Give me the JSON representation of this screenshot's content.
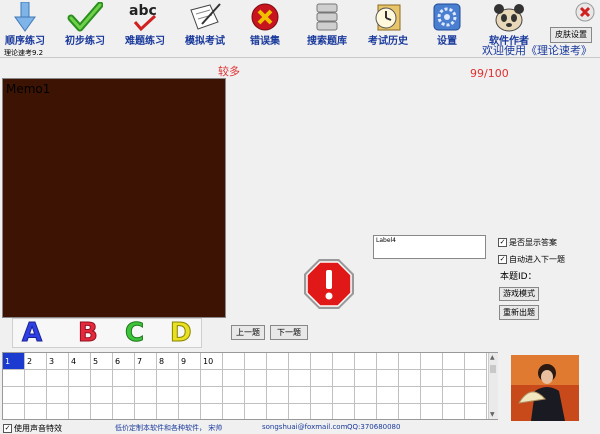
{
  "toolbar": {
    "buttons": [
      {
        "label": "顺序练习",
        "icon": "down-arrow-icon"
      },
      {
        "label": "初步练习",
        "icon": "checkmark-icon"
      },
      {
        "label": "难题练习",
        "icon": "abc-check-icon"
      },
      {
        "label": "模拟考试",
        "icon": "exam-paper-icon"
      },
      {
        "label": "错误集",
        "icon": "error-x-icon"
      },
      {
        "label": "搜索题库",
        "icon": "database-icon"
      },
      {
        "label": "考试历史",
        "icon": "clock-history-icon"
      },
      {
        "label": "设置",
        "icon": "settings-gear-icon"
      },
      {
        "label": "软件作者",
        "icon": "panda-avatar-icon"
      }
    ],
    "skin_button": "皮肤设置",
    "close_icon": "close-icon"
  },
  "welcome_text": "欢迎使用《理论速考》",
  "app_version": "理论速考9.2",
  "difficulty": "较多",
  "progress": "99/100",
  "memo_text": "Memo1",
  "options": [
    {
      "letter": "A",
      "color": "#2f3fe6"
    },
    {
      "letter": "B",
      "color": "#e6283c"
    },
    {
      "letter": "C",
      "color": "#3ec43a"
    },
    {
      "letter": "D",
      "color": "#e8e020"
    }
  ],
  "nav": {
    "prev": "上一题",
    "next": "下一题"
  },
  "warning_icon": "stop-warning-icon",
  "label4": "Label4",
  "checkboxes": {
    "show_answer": "是否显示答案",
    "auto_next": "自动进入下一题",
    "sound": "使用声音特效"
  },
  "question_id_label": "本题ID：",
  "game_mode_button": "游戏模式",
  "reshuffle_button": "重新出题",
  "question_grid": {
    "selected": "1",
    "numbers": [
      "1",
      "2",
      "3",
      "4",
      "5",
      "6",
      "7",
      "8",
      "9",
      "10"
    ]
  },
  "footer": {
    "custom_text": "低价定制本软件和各种软件， 宋帅",
    "email": "songshuai@foxmail.com",
    "qq": "QQ:370680080"
  },
  "colors": {
    "accent_blue": "#1a3a9c",
    "red_text": "#e03030",
    "memo_bg": "#3d1403"
  }
}
